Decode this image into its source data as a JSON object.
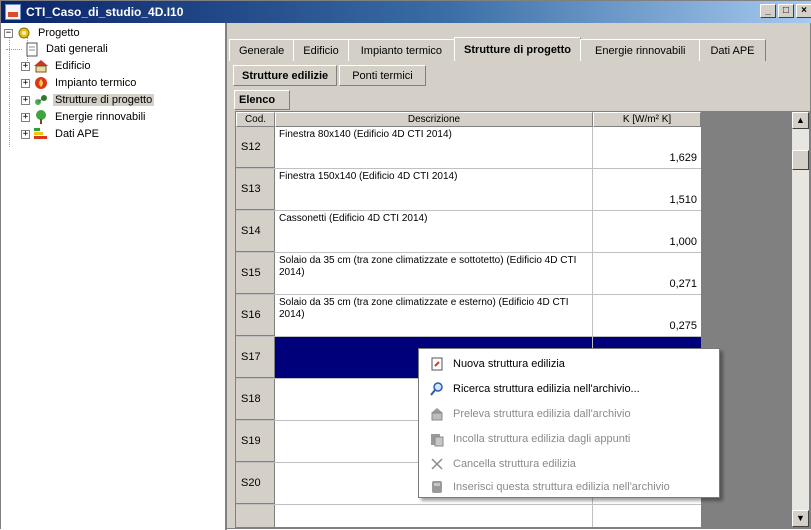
{
  "window": {
    "title": "CTI_Caso_di_studio_4D.I10",
    "buttons": [
      "_",
      "□",
      "×"
    ]
  },
  "tree": {
    "root": "Progetto",
    "items": [
      {
        "label": "Dati generali",
        "icon": "document-icon"
      },
      {
        "label": "Edificio",
        "icon": "house-icon"
      },
      {
        "label": "Impianto termico",
        "icon": "flame-icon"
      },
      {
        "label": "Strutture di progetto",
        "icon": "structure-icon",
        "selected": true
      },
      {
        "label": "Energie rinnovabili",
        "icon": "tree-icon"
      },
      {
        "label": "Dati APE",
        "icon": "energy-label-icon"
      }
    ]
  },
  "tabs": [
    "Generale",
    "Edificio",
    "Impianto termico",
    "Strutture di progetto",
    "Energie rinnovabili",
    "Dati APE"
  ],
  "active_tab": "Strutture di progetto",
  "subtabs": [
    "Strutture edilizie",
    "Ponti termici"
  ],
  "list_tab": "Elenco",
  "grid": {
    "headers": {
      "code": "Cod.",
      "desc": "Descrizione",
      "k": "K [W/m² K]"
    },
    "rows": [
      {
        "code": "S12",
        "desc": "Finestra 80x140  (Edificio 4D CTI 2014)",
        "k": "1,629"
      },
      {
        "code": "S13",
        "desc": "Finestra 150x140  (Edificio 4D CTI 2014)",
        "k": "1,510"
      },
      {
        "code": "S14",
        "desc": "Cassonetti (Edificio 4D CTI 2014)",
        "k": "1,000"
      },
      {
        "code": "S15",
        "desc": "Solaio da 35 cm (tra zone climatizzate e sottotetto)  (Edificio 4D CTI 2014)",
        "k": "0,271"
      },
      {
        "code": "S16",
        "desc": "Solaio da 35 cm (tra zone climatizzate e esterno)  (Edificio 4D CTI 2014)",
        "k": "0,275"
      },
      {
        "code": "S17",
        "desc": "",
        "k": "",
        "selected": true
      },
      {
        "code": "S18",
        "desc": "",
        "k": ""
      },
      {
        "code": "S19",
        "desc": "",
        "k": ""
      },
      {
        "code": "S20",
        "desc": "",
        "k": ""
      }
    ]
  },
  "context_menu": [
    {
      "label": "Nuova struttura edilizia",
      "icon": "new-document-icon",
      "enabled": true
    },
    {
      "label": "Ricerca struttura edilizia nell'archivio...",
      "icon": "search-icon",
      "enabled": true
    },
    {
      "label": "Preleva struttura edilizia dall'archivio",
      "icon": "archive-house-icon",
      "enabled": false
    },
    {
      "label": "Incolla struttura edilizia dagli appunti",
      "icon": "paste-icon",
      "enabled": false
    },
    {
      "label": "Cancella struttura edilizia",
      "icon": "delete-icon",
      "enabled": false
    },
    {
      "label": "Inserisci questa struttura edilizia nell'archivio",
      "icon": "save-to-archive-icon",
      "enabled": false
    }
  ]
}
